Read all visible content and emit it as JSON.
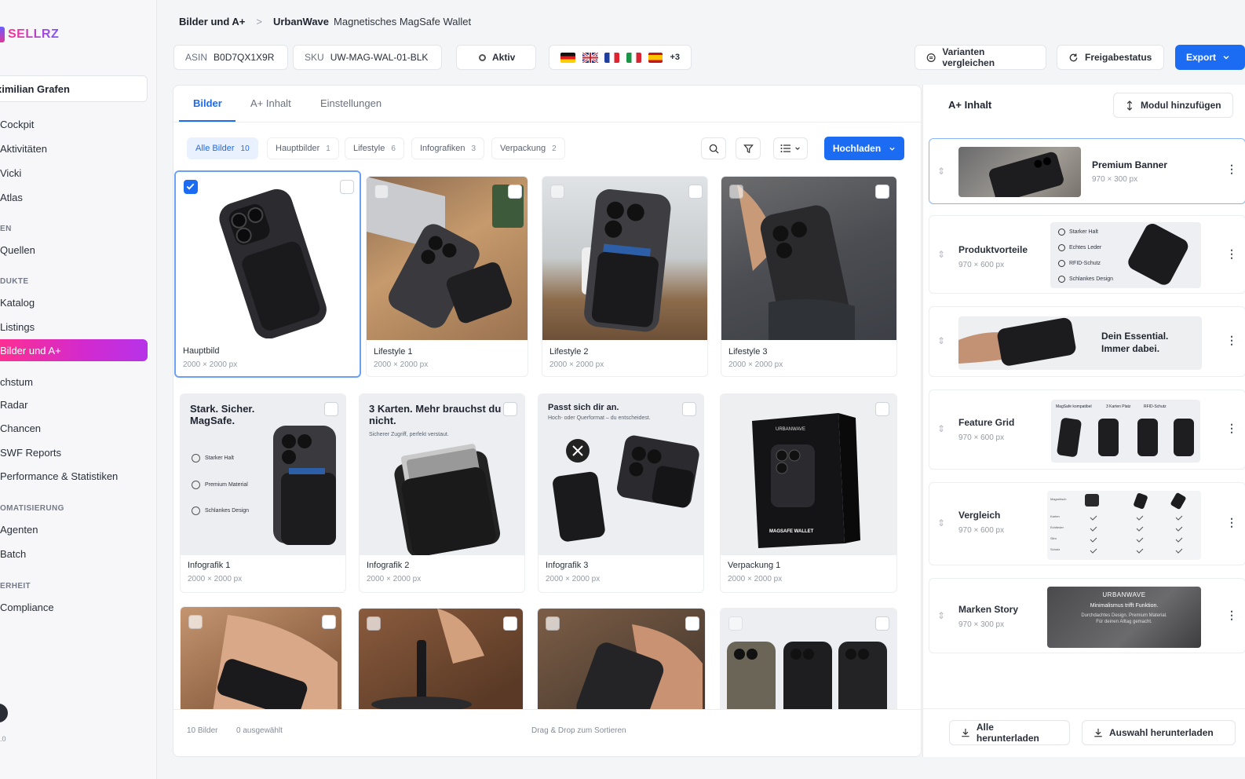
{
  "app": {
    "logo": "SELLRZ",
    "version": ".0"
  },
  "sidebar": {
    "user": "ximilian Grafen",
    "items": [
      {
        "label": "Cockpit"
      },
      {
        "label": "Aktivitäten"
      },
      {
        "label": "Vicki"
      },
      {
        "label": "Atlas"
      }
    ],
    "section_sources": "EN",
    "item_quellen": "Quellen",
    "section_products": "DUKTE",
    "item_katalog": "Katalog",
    "item_listings": "Listings",
    "item_active": "Bilder und A+",
    "item_wachstum": "chstum",
    "item_radar": "Radar",
    "item_chancen": "Chancen",
    "item_swf": "SWF Reports",
    "item_performance": "Performance & Statistiken",
    "section_automation": "OMATISIERUNG",
    "item_agenten": "Agenten",
    "item_batch": "Batch",
    "section_security": "ERHEIT",
    "item_compliance": "Compliance"
  },
  "header": {
    "breadcrumb_root": "Bilder und A+",
    "breadcrumb_sep": ">",
    "brand": "UrbanWave",
    "product": "Magnetisches MagSafe Wallet",
    "asin_label": "ASIN",
    "asin_value": "B0D7QX1X9R",
    "sku_label": "SKU",
    "sku_value": "UW-MAG-WAL-01-BLK",
    "status": "Aktiv",
    "more_flags": "+3",
    "compare_variants": "Varianten vergleichen",
    "approval_status": "Freigabestatus",
    "export": "Export"
  },
  "tabs": {
    "images": "Bilder",
    "aplus": "A+ Inhalt",
    "settings": "Einstellungen"
  },
  "filters": [
    {
      "label": "Alle Bilder",
      "count": "10"
    },
    {
      "label": "Hauptbilder",
      "count": "1"
    },
    {
      "label": "Lifestyle",
      "count": "6"
    },
    {
      "label": "Infografiken",
      "count": "3"
    },
    {
      "label": "Verpackung",
      "count": "2"
    }
  ],
  "upload": "Hochladen",
  "images": [
    {
      "name": "Hauptbild",
      "dims": "2000 × 2000 px"
    },
    {
      "name": "Lifestyle 1",
      "dims": "2000 × 2000 px"
    },
    {
      "name": "Lifestyle 2",
      "dims": "2000 × 2000 px"
    },
    {
      "name": "Lifestyle 3",
      "dims": "2000 × 2000 px"
    },
    {
      "name": "Infografik 1",
      "dims": "2000 × 2000 px"
    },
    {
      "name": "Infografik 2",
      "dims": "2000 × 2000 px"
    },
    {
      "name": "Infografik 3",
      "dims": "2000 × 2000 px"
    },
    {
      "name": "Verpackung 1",
      "dims": "2000 × 2000 px"
    }
  ],
  "thumb_text": {
    "info1_title": "Stark. Sicher. MagSafe.",
    "info1_f1": "Starker Halt",
    "info1_f2": "Premium Material",
    "info1_f3": "Schlankes Design",
    "info2_title": "3 Karten. Mehr brauchst du nicht.",
    "info2_sub": "Sicherer Zugriff, perfekt verstaut.",
    "info3_title": "Passt sich dir an.",
    "info3_sub": "Hoch- oder Querformat – du entscheidest.",
    "box_brand": "URBANWAVE",
    "box_label": "MAGSAFE WALLET"
  },
  "footer": {
    "count": "10 Bilder",
    "selected": "0 ausgewählt",
    "hint": "Drag & Drop zum Sortieren"
  },
  "aplus": {
    "title": "A+ Inhalt",
    "add_module": "Modul hinzufügen",
    "modules": [
      {
        "name": "Premium Banner",
        "dims": "970 × 300 px"
      },
      {
        "name": "Produktvorteile",
        "dims": "970 × 600 px"
      },
      {
        "name": "",
        "dims": ""
      },
      {
        "name": "Feature Grid",
        "dims": "970 × 600 px"
      },
      {
        "name": "Vergleich",
        "dims": "970 × 600 px"
      },
      {
        "name": "Marken Story",
        "dims": "970 × 300 px"
      }
    ],
    "m2_f1": "Starker Halt",
    "m2_f2": "Echtes Leder",
    "m2_f3": "RFID-Schutz",
    "m2_f4": "Schlankes Design",
    "m3_text": "Dein Essential. Immer dabei.",
    "m4_l1": "MagSafe kompatibel",
    "m4_l2": "3 Karten Platz",
    "m4_l3": "RFID-Schutz",
    "m5_rows": [
      "Magnetisch",
      "Karten",
      "Echtleder",
      "Slim",
      "Schutz"
    ],
    "m6_brand": "URBANWAVE",
    "m6_line1": "Minimalismus trifft Funktion.",
    "m6_line2": "Durchdachtes Design. Premium Material.",
    "m6_line3": "Für deinen Alltag gemacht.",
    "download_all": "Alle herunterladen",
    "download_selection": "Auswahl herunterladen"
  },
  "colors": {
    "accent": "#1b6cf2",
    "active_nav": "#d12ad0"
  }
}
